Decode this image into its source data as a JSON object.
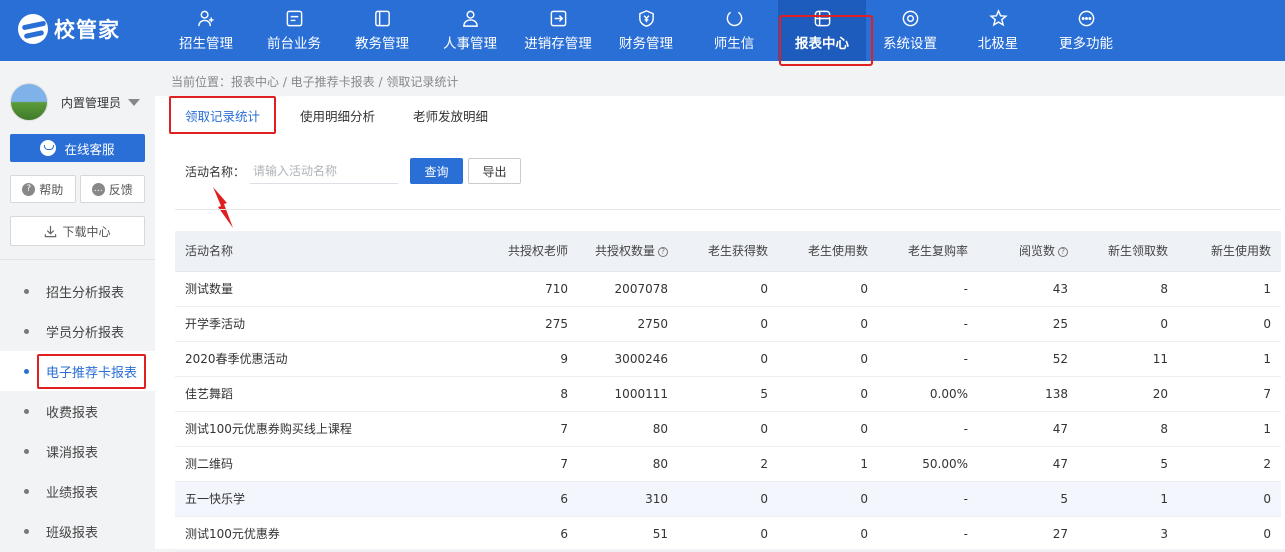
{
  "app": {
    "logo_text": "校管家"
  },
  "nav": [
    {
      "label": "招生管理",
      "icon": "user-plus-icon"
    },
    {
      "label": "前台业务",
      "icon": "monitor-icon"
    },
    {
      "label": "教务管理",
      "icon": "book-icon"
    },
    {
      "label": "人事管理",
      "icon": "person-icon"
    },
    {
      "label": "进销存管理",
      "icon": "inventory-icon"
    },
    {
      "label": "财务管理",
      "icon": "money-shield-icon"
    },
    {
      "label": "师生信",
      "icon": "chat-icon"
    },
    {
      "label": "报表中心",
      "icon": "report-grid-icon",
      "active": true
    },
    {
      "label": "系统设置",
      "icon": "settings-icon"
    },
    {
      "label": "北极星",
      "icon": "star-icon"
    },
    {
      "label": "更多功能",
      "icon": "more-icon"
    }
  ],
  "sidebar": {
    "user_name": "内置管理员",
    "service_label": "在线客服",
    "help_label": "帮助",
    "feedback_label": "反馈",
    "download_label": "下载中心",
    "items": [
      {
        "label": "招生分析报表"
      },
      {
        "label": "学员分析报表"
      },
      {
        "label": "电子推荐卡报表",
        "active": true
      },
      {
        "label": "收费报表"
      },
      {
        "label": "课消报表"
      },
      {
        "label": "业绩报表"
      },
      {
        "label": "班级报表"
      }
    ]
  },
  "breadcrumb": "当前位置：报表中心 / 电子推荐卡报表 / 领取记录统计",
  "tabs": [
    {
      "label": "领取记录统计",
      "active": true
    },
    {
      "label": "使用明细分析"
    },
    {
      "label": "老师发放明细"
    }
  ],
  "filter": {
    "label": "活动名称：",
    "placeholder": "请输入活动名称",
    "query_label": "查询",
    "export_label": "导出"
  },
  "table": {
    "headers": [
      "活动名称",
      "共授权老师",
      "共授权数量",
      "老生获得数",
      "老生使用数",
      "老生复购率",
      "阅览数",
      "新生领取数",
      "新生使用数"
    ],
    "rows": [
      [
        "测试数量",
        "710",
        "2007078",
        "0",
        "0",
        "-",
        "43",
        "8",
        "1"
      ],
      [
        "开学季活动",
        "275",
        "2750",
        "0",
        "0",
        "-",
        "25",
        "0",
        "0"
      ],
      [
        "2020春季优惠活动",
        "9",
        "3000246",
        "0",
        "0",
        "-",
        "52",
        "11",
        "1"
      ],
      [
        "佳艺舞蹈",
        "8",
        "1000111",
        "5",
        "0",
        "0.00%",
        "138",
        "20",
        "7"
      ],
      [
        "测试100元优惠券购买线上课程",
        "7",
        "80",
        "0",
        "0",
        "-",
        "47",
        "8",
        "1"
      ],
      [
        "测二维码",
        "7",
        "80",
        "2",
        "1",
        "50.00%",
        "47",
        "5",
        "2"
      ],
      [
        "五一快乐学",
        "6",
        "310",
        "0",
        "0",
        "-",
        "5",
        "1",
        "0"
      ],
      [
        "测试100元优惠券",
        "6",
        "51",
        "0",
        "0",
        "-",
        "27",
        "3",
        "0"
      ]
    ]
  }
}
